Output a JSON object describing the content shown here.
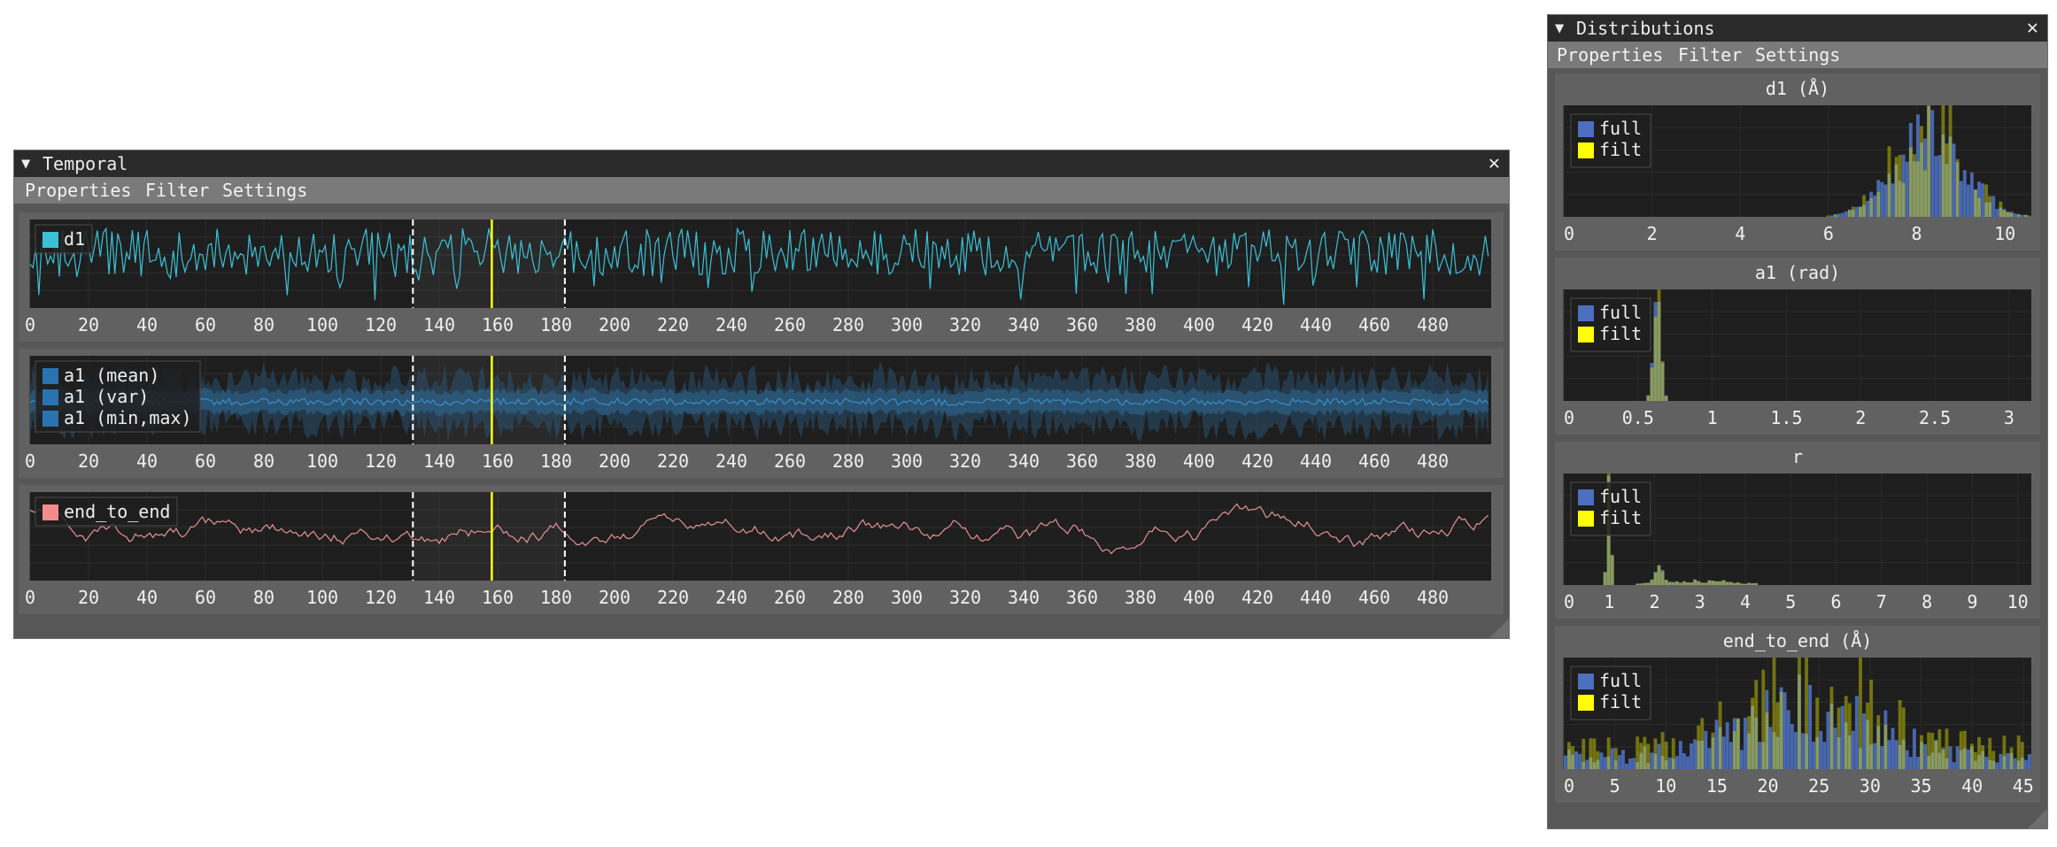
{
  "temporal": {
    "title": "Temporal",
    "close": "✕",
    "menu": [
      "Properties",
      "Filter",
      "Settings"
    ],
    "x_ticks": [
      "0",
      "20",
      "40",
      "60",
      "80",
      "100",
      "120",
      "140",
      "160",
      "180",
      "200",
      "220",
      "240",
      "260",
      "280",
      "300",
      "320",
      "340",
      "360",
      "380",
      "400",
      "420",
      "440",
      "460",
      "480"
    ],
    "frame_markers": {
      "left": 131,
      "current": 158,
      "right": 183
    },
    "plots": [
      {
        "legend": [
          "d1"
        ],
        "legend_colors": [
          "#3bc1d6"
        ],
        "line_color": "#3bc1d6",
        "kind": "noisy"
      },
      {
        "legend": [
          "a1 (mean)",
          "a1 (var)",
          "a1 (min,max)"
        ],
        "legend_colors": [
          "#2a73b1",
          "#2a73b1",
          "#2a73b1"
        ],
        "line_color": "#3d8dc4",
        "kind": "band"
      },
      {
        "legend": [
          "end_to_end"
        ],
        "legend_colors": [
          "#f28c8c"
        ],
        "line_color": "#e59191",
        "kind": "walk"
      }
    ]
  },
  "distributions": {
    "title": "Distributions",
    "close": "✕",
    "menu": [
      "Properties",
      "Filter",
      "Settings"
    ],
    "legend": [
      "full",
      "filt"
    ],
    "legend_colors": [
      "#4c6fbf",
      "#ffff00"
    ],
    "plots": [
      {
        "title": "d1 (Å)",
        "ticks": [
          "0",
          "2",
          "4",
          "6",
          "8",
          "10"
        ],
        "xmax": 10.6,
        "peak": 8.3,
        "width": 1.1,
        "mode": "peaked"
      },
      {
        "title": "a1 (rad)",
        "ticks": [
          "0",
          "0.5",
          "1",
          "1.5",
          "2",
          "2.5",
          "3"
        ],
        "xmax": 3.15,
        "peak": 0.63,
        "width": 0.035,
        "mode": "narrow"
      },
      {
        "title": "r",
        "ticks": [
          "0",
          "1",
          "2",
          "3",
          "4",
          "5",
          "6",
          "7",
          "8",
          "9",
          "10"
        ],
        "xmax": 10.3,
        "peak": 1.0,
        "width": 0.05,
        "mode": "spikes"
      },
      {
        "title": "end_to_end (Å)",
        "ticks": [
          "0",
          "5",
          "10",
          "15",
          "20",
          "25",
          "30",
          "35",
          "40",
          "45"
        ],
        "xmax": 45.8,
        "peak": 24,
        "width": 9,
        "mode": "broad"
      }
    ]
  }
}
